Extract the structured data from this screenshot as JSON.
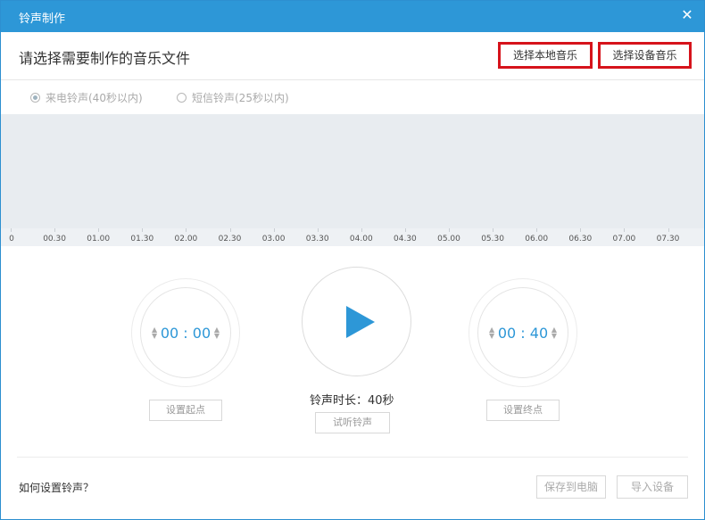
{
  "window": {
    "title": "铃声制作",
    "close_glyph": "✕"
  },
  "header": {
    "prompt": "请选择需要制作的音乐文件",
    "select_local_label": "选择本地音乐",
    "select_device_label": "选择设备音乐"
  },
  "ring_types": [
    {
      "label": "来电铃声(40秒以内)",
      "selected": true
    },
    {
      "label": "短信铃声(25秒以内)",
      "selected": false
    }
  ],
  "timeline": {
    "ticks": [
      "0",
      "00.30",
      "01.00",
      "01.30",
      "02.00",
      "02.30",
      "03.00",
      "03.30",
      "04.00",
      "04.30",
      "05.00",
      "05.30",
      "06.00",
      "06.30",
      "07.00",
      "07.30"
    ]
  },
  "start": {
    "time": "00 : 00",
    "button": "设置起点"
  },
  "end": {
    "time": "00 : 40",
    "button": "设置终点"
  },
  "player": {
    "duration_text": "铃声时长：40秒",
    "preview_button": "试听铃声"
  },
  "footer": {
    "help_link": "如何设置铃声？",
    "save_button": "保存到电脑",
    "device_button": "导入设备"
  },
  "colors": {
    "accent": "#2d97d7",
    "highlight_border": "#d6131b"
  }
}
